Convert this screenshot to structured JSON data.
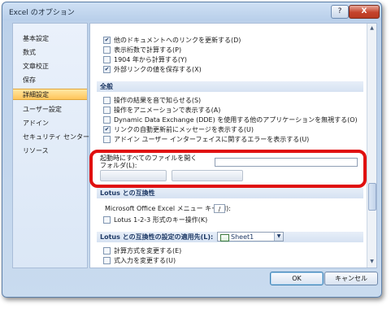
{
  "window": {
    "title": "Excel のオプション",
    "help": "?",
    "close": "X"
  },
  "sidebar": {
    "items": [
      "基本設定",
      "数式",
      "文章校正",
      "保存",
      "詳細設定",
      "ユーザー設定",
      "アドイン",
      "セキュリティ センター",
      "リソース"
    ],
    "active_index": 4
  },
  "content": {
    "top_options": [
      {
        "label": "他のドキュメントへのリンクを更新する(D)",
        "checked": true
      },
      {
        "label": "表示桁数で計算する(P)",
        "checked": false
      },
      {
        "label": "1904 年から計算する(Y)",
        "checked": false
      },
      {
        "label": "外部リンクの値を保存する(X)",
        "checked": true
      }
    ],
    "general": {
      "header": "全般",
      "options": [
        {
          "label": "操作の結果を音で知らせる(S)",
          "checked": false
        },
        {
          "label": "操作をアニメーションで表示する(A)",
          "checked": false
        },
        {
          "label": "Dynamic Data Exchange (DDE) を使用する他のアプリケーションを無視する(O)",
          "checked": false
        },
        {
          "label": "リンクの自動更新前にメッセージを表示する(U)",
          "checked": true
        },
        {
          "label": "アドイン ユーザー インターフェイスに関するエラーを表示する(U)",
          "checked": false
        }
      ],
      "startup_label_line1": "起動時にすべてのファイルを開く",
      "startup_label_line2": "フォルダ(L):",
      "startup_value": ""
    },
    "lotus": {
      "header": "Lotus との互換性",
      "menu_key_label": "Microsoft Office Excel メニュー キー(M):",
      "menu_key_value": "/",
      "nav_keys_label": "Lotus 1-2-3 形式のキー操作(K)",
      "nav_keys_checked": false
    },
    "lotus_settings": {
      "header": "Lotus との互換性の設定の適用先(L):",
      "sheet_value": "Sheet1",
      "options": [
        {
          "label": "計算方式を変更する(E)",
          "checked": false
        },
        {
          "label": "式入力を変更する(U)",
          "checked": false
        }
      ]
    }
  },
  "footer": {
    "ok": "OK",
    "cancel": "キャンセル"
  },
  "colors": {
    "highlight": "#e01010",
    "section_text": "#1f3a66"
  }
}
